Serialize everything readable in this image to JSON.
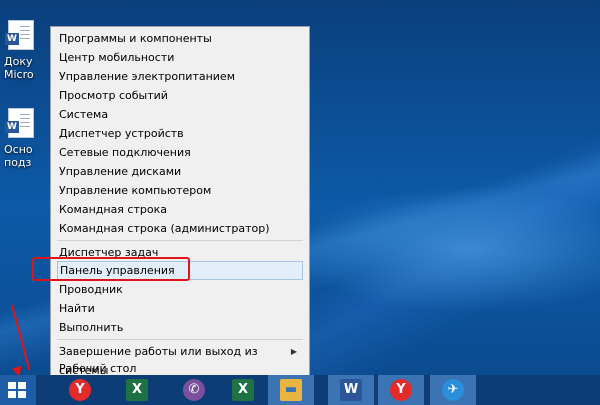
{
  "desktop": {
    "icons": [
      {
        "label1": "Доку",
        "label2": "Micro",
        "glyph": "W"
      },
      {
        "label1": "Осно",
        "label2": "подз",
        "glyph": "W"
      }
    ]
  },
  "menu": {
    "items": [
      {
        "label": "Программы и компоненты"
      },
      {
        "label": "Центр мобильности"
      },
      {
        "label": "Управление электропитанием"
      },
      {
        "label": "Просмотр событий"
      },
      {
        "label": "Система"
      },
      {
        "label": "Диспетчер устройств"
      },
      {
        "label": "Сетевые подключения"
      },
      {
        "label": "Управление дисками"
      },
      {
        "label": "Управление компьютером"
      },
      {
        "label": "Командная строка"
      },
      {
        "label": "Командная строка (администратор)"
      },
      {
        "label": "Диспетчер задач"
      },
      {
        "label": "Панель управления"
      },
      {
        "label": "Проводник"
      },
      {
        "label": "Найти"
      },
      {
        "label": "Выполнить"
      },
      {
        "label": "Завершение работы или выход из системы"
      },
      {
        "label": "Рабочий стол"
      }
    ],
    "submenu_arrow": "▶",
    "highlight_color": "#e3eefb",
    "annotation_color": "#e0151b"
  },
  "taskbar": {
    "apps": [
      {
        "name": "yandex-browser",
        "glyph": "Y",
        "color": "#e32b2b"
      },
      {
        "name": "excel",
        "glyph": "X",
        "color": "#1f7244"
      },
      {
        "name": "viber",
        "glyph": "✆",
        "color": "#7b519d"
      },
      {
        "name": "excel-2",
        "glyph": "X",
        "color": "#1f7244"
      },
      {
        "name": "file-explorer",
        "glyph": "▬",
        "color": "#e8b640"
      },
      {
        "name": "word",
        "glyph": "W",
        "color": "#2b579a"
      },
      {
        "name": "yandex-browser-2",
        "glyph": "Y",
        "color": "#e32b2b"
      },
      {
        "name": "app-bird",
        "glyph": "✈",
        "color": "#2a8fd8"
      }
    ]
  }
}
